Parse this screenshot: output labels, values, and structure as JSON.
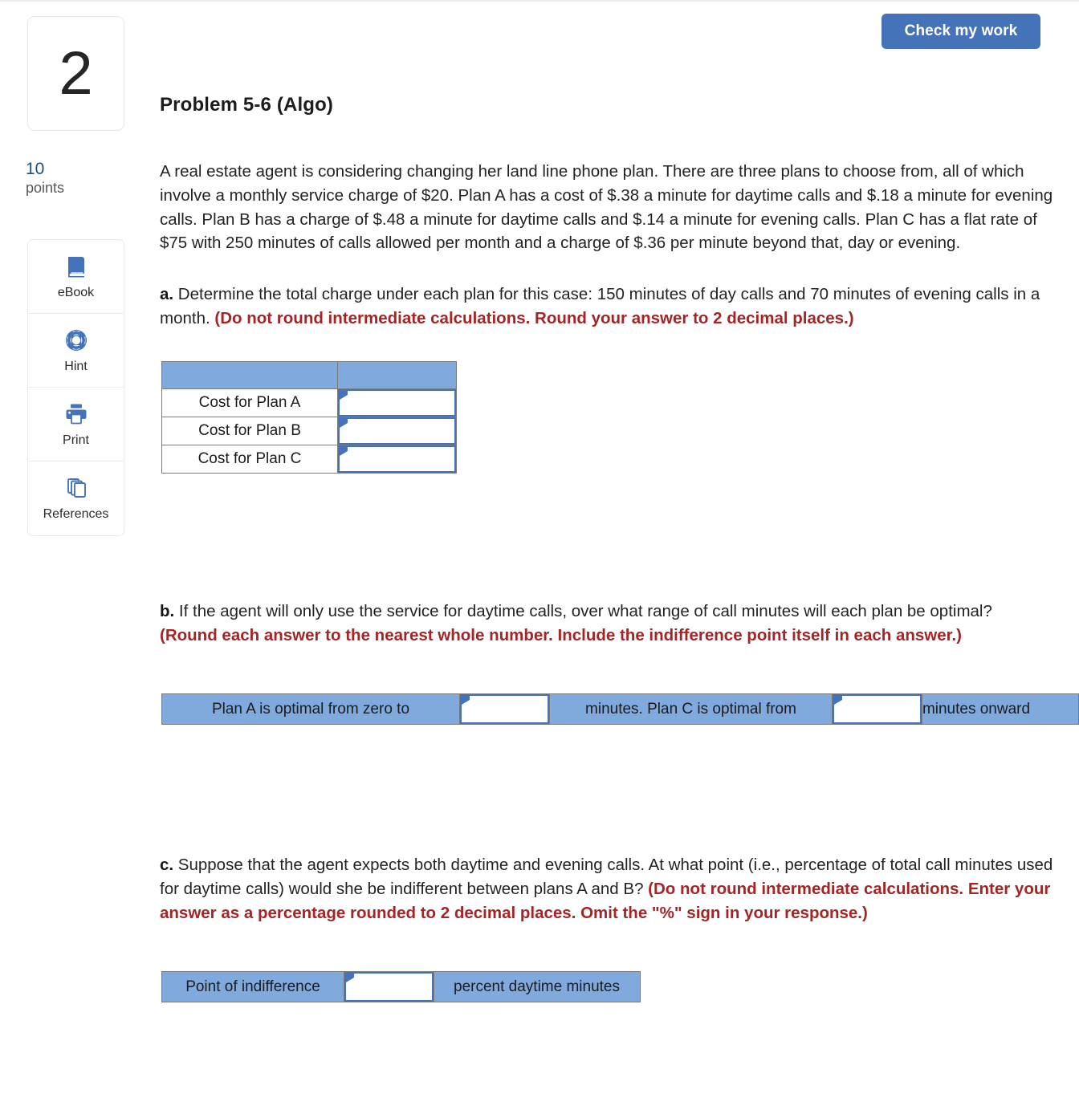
{
  "header": {
    "check_button_label": "Check my work",
    "question_number": "2",
    "problem_title": "Problem 5-6 (Algo)"
  },
  "sidebar": {
    "points_value": "10",
    "points_label": "points",
    "tools": [
      {
        "label": "eBook",
        "icon": "book-icon"
      },
      {
        "label": "Hint",
        "icon": "life-ring-icon"
      },
      {
        "label": "Print",
        "icon": "printer-icon"
      },
      {
        "label": "References",
        "icon": "copy-pages-icon"
      }
    ]
  },
  "content": {
    "intro": "A real estate agent is considering changing her land line phone plan. There are three plans to choose from, all of which involve a monthly service charge of $20. Plan A has a cost of $.38 a minute for daytime calls and $.18 a minute for evening calls. Plan B has a charge of $.48 a minute for daytime calls and $.14 a minute for evening calls. Plan C has a flat rate of $75 with 250 minutes of calls allowed per month and a charge of $.36 per minute beyond that, day or evening.",
    "part_a": {
      "label": "a.",
      "question": " Determine the total charge under each plan for this case: 150 minutes of day calls and 70 minutes of evening calls in a month. ",
      "instruction": "(Do not round intermediate calculations. Round your answer to 2 decimal places.)",
      "table": {
        "header_cells": [
          "",
          ""
        ],
        "rows": [
          {
            "label": "Cost for Plan A",
            "value": ""
          },
          {
            "label": "Cost for Plan B",
            "value": ""
          },
          {
            "label": "Cost for Plan C",
            "value": ""
          }
        ]
      }
    },
    "part_b": {
      "label": "b.",
      "question": " If the agent will only use the service for daytime calls, over what range of call minutes will each plan be optimal? ",
      "instruction": "(Round each answer to the nearest whole number. Include the indifference point itself in each answer.)",
      "bar": {
        "text_1": "Plan A is optimal from zero to",
        "input_1": "",
        "text_2": "minutes. Plan C is optimal from",
        "input_2": "",
        "text_3": "minutes onward"
      }
    },
    "part_c": {
      "label": "c.",
      "question": " Suppose that the agent expects both daytime and evening calls. At what point (i.e., percentage of total call minutes used for daytime calls) would she be indifferent between plans A and B? ",
      "instruction": "(Do not round intermediate calculations.  Enter your answer as a percentage rounded to 2 decimal places.  Omit the \"%\" sign in your response.)",
      "bar": {
        "text_1": "Point of indifference",
        "input_1": "",
        "text_2": "percent daytime minutes"
      }
    }
  },
  "colors": {
    "accent_blue": "#4573B9",
    "cell_blue": "#80AADE",
    "emphasis_red": "#A32525",
    "points_blue": "#1F4E79"
  }
}
